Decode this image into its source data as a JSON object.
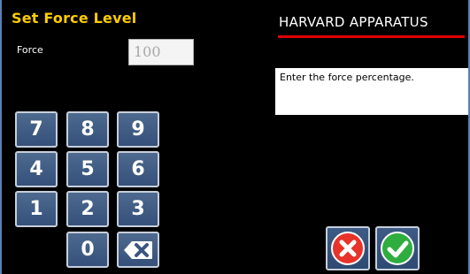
{
  "header": {
    "title": "Set Force Level",
    "brand": "HARVARD APPARATUS"
  },
  "force": {
    "label": "Force",
    "value": "100"
  },
  "message": "Enter the force percentage.",
  "keypad": {
    "k7": "7",
    "k8": "8",
    "k9": "9",
    "k4": "4",
    "k5": "5",
    "k6": "6",
    "k1": "1",
    "k2": "2",
    "k3": "3",
    "k0": "0"
  },
  "icons": {
    "backspace": "backspace-icon",
    "cancel": "cancel-icon",
    "confirm": "confirm-icon"
  },
  "colors": {
    "title": "#ffcc00",
    "brand_rule": "#e00000",
    "key_face": "#4e6a8f",
    "key_border": "#c7cfdc",
    "cancel": "#e8332a",
    "confirm": "#2fae3f"
  }
}
